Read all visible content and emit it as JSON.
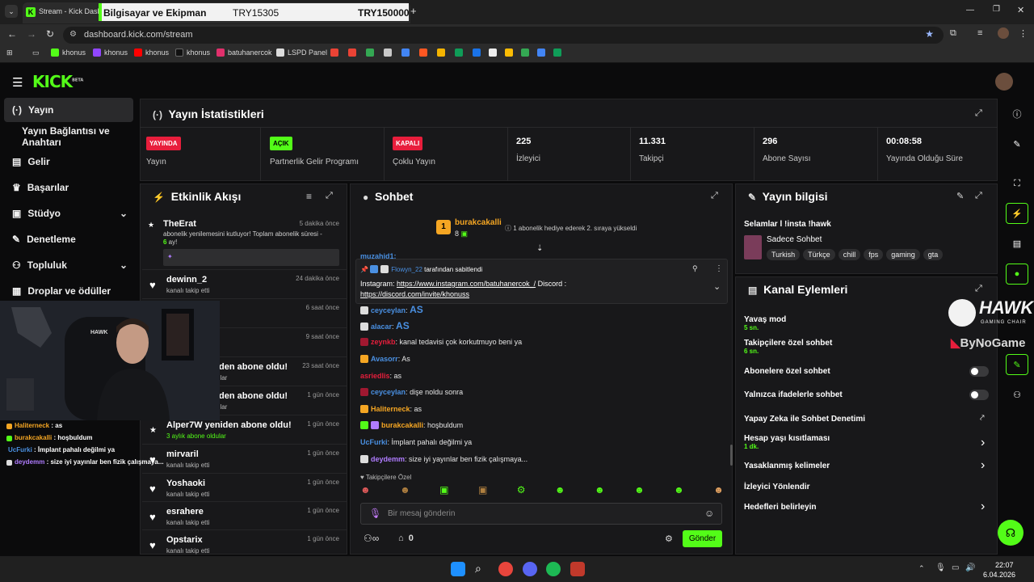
{
  "browser": {
    "tab_title": "Stream - Kick Dashb",
    "tab_overlay_label": "Bilgisayar ve Ekipman",
    "tab_overlay_price1": "TRY15305",
    "tab_overlay_price2": "TRY150000",
    "url": "dashboard.kick.com/stream",
    "bookmarks": [
      "khonus",
      "khonus",
      "khonus",
      "khonus",
      "batuhanercok",
      "LSPD Panel"
    ]
  },
  "kick": {
    "logo": "KICK",
    "logo_sup": "BETA"
  },
  "sidebar": {
    "items": [
      {
        "label": "Yayın",
        "icon": "broadcast-icon"
      },
      {
        "label": "Yayın Bağlantısı ve Anahtarı",
        "icon": ""
      },
      {
        "label": "Gelir",
        "icon": "chart-icon"
      },
      {
        "label": "Başarılar",
        "icon": "trophy-icon"
      },
      {
        "label": "Stüdyo",
        "icon": "studio-icon"
      },
      {
        "label": "Denetleme",
        "icon": "wrench-icon"
      },
      {
        "label": "Topluluk",
        "icon": "community-icon"
      },
      {
        "label": "Droplar ve ödüller",
        "icon": "drops-icon"
      }
    ]
  },
  "stats": {
    "title": "Yayın İstatistikleri",
    "cards": [
      {
        "badge": "YAYINDA",
        "label": "Yayın",
        "badge_color": "#e81e3c"
      },
      {
        "badge": "AÇIK",
        "label": "Partnerlik Gelir Programı",
        "badge_color": "#53fc18"
      },
      {
        "badge": "KAPALI",
        "label": "Çoklu Yayın",
        "badge_color": "#e81e3c"
      },
      {
        "value": "225",
        "label": "İzleyici"
      },
      {
        "value": "11.331",
        "label": "Takipçi"
      },
      {
        "value": "296",
        "label": "Abone Sayısı"
      },
      {
        "value": "00:08:58",
        "label": "Yayında Olduğu Süre"
      }
    ]
  },
  "activity": {
    "title": "Etkinlik Akışı",
    "first": {
      "name": "TheErat",
      "time": "5 dakika önce",
      "text": "abonelik yenilemesini kutluyor! Toplam abonelik süresi -",
      "months": "6",
      "months_suffix": " ay!"
    },
    "items": [
      {
        "name": "dewinn_2",
        "sub": "kanalı takip etti",
        "time": "24 dakika önce"
      },
      {
        "name": "",
        "sub": "",
        "time": "6 saat önce"
      },
      {
        "name": "",
        "sub": "",
        "time": "9 saat önce"
      },
      {
        "name": "iden abone oldu!",
        "sub": "ular",
        "time": "23 saat önce"
      },
      {
        "name": "iden abone oldu!",
        "sub": "ular",
        "time": "1 gün önce"
      },
      {
        "name": "Alper7W yeniden abone oldu!",
        "sub": "3 aylık abone oldular",
        "time": "1 gün önce"
      },
      {
        "name": "mirvaril",
        "sub": "kanalı takip etti",
        "time": "1 gün önce"
      },
      {
        "name": "Yoshaoki",
        "sub": "kanalı takip etti",
        "time": "1 gün önce"
      },
      {
        "name": "esrahere",
        "sub": "kanalı takip etti",
        "time": "1 gün önce"
      },
      {
        "name": "Opstarix",
        "sub": "kanalı takip etti",
        "time": "1 gün önce"
      }
    ]
  },
  "overlay_chat": [
    {
      "user": "Haliterneck",
      "msg": " : as",
      "color": "#f5a623"
    },
    {
      "user": "burakcakalli",
      "msg": " : hoşbuldum",
      "color": "#f5a623"
    },
    {
      "user": "UcFurki",
      "msg": " : İmplant pahalı değilmi ya",
      "color": "#4a90e2"
    },
    {
      "user": "deydemm",
      "msg": " : size iyi yayınlar ben fizik çalışmaya...",
      "color": "#b07cff"
    }
  ],
  "chat": {
    "title": "Sohbet",
    "gift_user": "burakcakalli",
    "gift_level": "1",
    "gift_count": "8",
    "gift_text": "1 abonelik hediye ederek 2. sıraya yükseldi",
    "pinned_by_user": "Flowyn_22",
    "pinned_by_suffix": " tarafından sabitlendi",
    "pinned_msg_prefix": "Instagram: ",
    "pinned_link1": "https://www.instagram.com/batuhanercok_/",
    "pinned_mid": " Discord :",
    "pinned_link2": "https://discord.com/invite/khonuss",
    "partial_top": "muzahid1:",
    "messages": [
      {
        "user": "ceyceylan",
        "text": "AS",
        "color": "#4a90e2",
        "big": true
      },
      {
        "user": "alacar",
        "text": "AS",
        "color": "#4a90e2",
        "big": true
      },
      {
        "user": "zeynkb",
        "text": "kanal tedavisi çok korkutmuyo beni ya",
        "color": "#e81e3c"
      },
      {
        "user": "Avasorr",
        "text": "As",
        "color": "#4a90e2"
      },
      {
        "user": "asriedlis",
        "text": "as",
        "color": "#e81e3c"
      },
      {
        "user": "ceyceylan",
        "text": "dişe noldu sonra",
        "color": "#4a90e2"
      },
      {
        "user": "Haliterneck",
        "text": "as",
        "color": "#f5a623"
      },
      {
        "user": "burakcakalli",
        "text": "hoşbuldum",
        "color": "#f5a623"
      },
      {
        "user": "UcFurki",
        "text": "İmplant pahalı değilmi ya",
        "color": "#4a90e2"
      },
      {
        "user": "deydemm",
        "text": "size iyi yayınlar ben fizik çalışmaya...",
        "color": "#b07cff"
      }
    ],
    "followers_only": "Takipçilere Özel",
    "input_placeholder": "Bir mesaj gönderin",
    "points": "0",
    "send_label": "Gönder"
  },
  "stream_info": {
    "title": "Yayın bilgisi",
    "stream_title": "Selamlar l !insta !hawk",
    "category": "Sadece Sohbet",
    "tags": [
      "Turkish",
      "Türkçe",
      "chill",
      "fps",
      "gaming",
      "gta"
    ]
  },
  "channel_actions": {
    "title": "Kanal Eylemleri",
    "slow_mode": "Yavaş mod",
    "slow_mode_val": "5 sn.",
    "followers_chat": "Takipçilere özel sohbet",
    "followers_chat_val": "6 sn.",
    "subs_chat": "Abonelere özel sohbet",
    "emote_chat": "Yalnızca ifadelerle sohbet",
    "ai_mod": "Yapay Zeka ile Sohbet Denetimi",
    "age_restrict": "Hesap yaşı kısıtlaması",
    "age_restrict_val": "1 dk.",
    "banned_words": "Yasaklanmış kelimeler",
    "redirect": "İzleyici Yönlendir",
    "goals": "Hedefleri belirleyin"
  },
  "sponsor": {
    "hawk": "HAWK",
    "hawk_sub": "GAMING CHAIR",
    "bynogame": "ByNoGame"
  },
  "taskbar": {
    "time": "22:07",
    "date": "6.04.2026"
  }
}
